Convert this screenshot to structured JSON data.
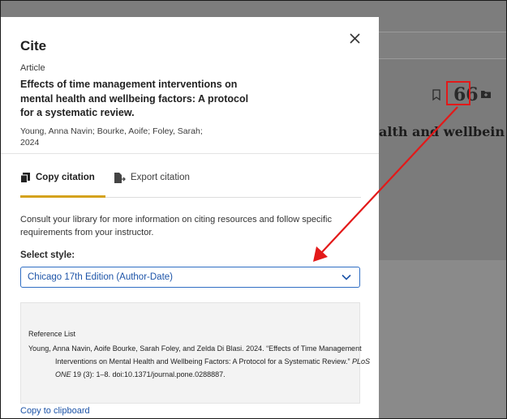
{
  "background": {
    "heading_fragment": "alth and wellbein",
    "icons": [
      "bookmark-icon",
      "quote-icon",
      "folder-plus-icon"
    ],
    "quote_glyph": "66"
  },
  "dialog": {
    "title": "Cite",
    "item_type": "Article",
    "article_title": "Effects of time management interventions on mental health and wellbeing factors: A protocol for a systematic review.",
    "authors": "Young, Anna Navin; Bourke, Aoife; Foley, Sarah;",
    "year": "2024",
    "tabs": [
      {
        "label": "Copy citation",
        "icon": "copy-icon",
        "active": true
      },
      {
        "label": "Export citation",
        "icon": "export-icon",
        "active": false
      }
    ],
    "info_text": "Consult your library for more information on citing resources and follow specific requirements from your instructor.",
    "style_label": "Select style:",
    "selected_style": "Chicago 17th Edition (Author-Date)",
    "reference": {
      "heading": "Reference List",
      "text_before_journal": "Young, Anna Navin, Aoife Bourke, Sarah Foley, and Zelda Di Blasi. 2024. “Effects of Time Management Interventions on Mental Health and Wellbeing Factors: A Protocol for a Systematic Review.” ",
      "journal": "PLoS ONE",
      "text_after_journal": " 19 (3): 1–8. doi:10.1371/journal.pone.0288887."
    },
    "copy_link": "Copy to clipboard"
  },
  "annotation": {
    "color": "#e31919"
  }
}
